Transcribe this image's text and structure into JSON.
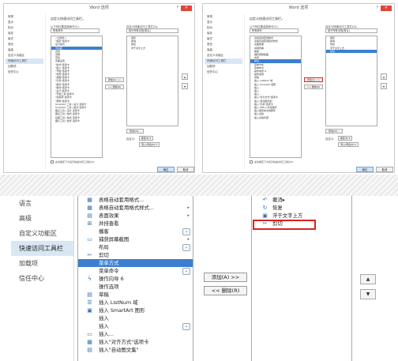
{
  "shared": {
    "window_title": "Word 选项",
    "help": "?",
    "close": "✕",
    "header": "自定义快速访问工具栏。",
    "from_label": "从下列位置选择命令(C):",
    "from_value": "所有命令",
    "customize_label": "自定义快速访问工具栏(Q):",
    "customize_value": "用于所有文档(默认)",
    "add_btn": "添加(A) >>",
    "remove_btn": "<< 删除(R)",
    "modify_btn": "修改(M)...",
    "custom_label": "自定义:",
    "reset_btn": "重置(E) ▾",
    "import_btn": "导入/导出(P) ▾",
    "ok_btn": "确定",
    "cancel_btn": "取消",
    "below_ribbon": "在功能区下方显示快速访问工具栏(H)"
  },
  "left_window": {
    "nav": [
      "常规",
      "显示",
      "校对",
      "保存",
      "版式",
      "语言",
      "高级",
      "自定义功能区",
      "快速访问工具栏",
      "加载项",
      "信任中心"
    ],
    "selected_nav": 8,
    "commands": [
      "<分隔符>",
      "\"保存\"选项卡",
      "显示格式",
      "页边距",
      "页眉",
      "页脚",
      "页码",
      "页面设置",
      "\"版式\"选项卡",
      "\"插入\"选项卡",
      "\"开始\"选项卡",
      "\"布局\"选项卡",
      "\"视图\"选项卡",
      "\"引用\"选项卡",
      "\"邮件\"选项卡",
      "\"审阅\"选项卡",
      "\"设计\"选项卡",
      "\"开发工具\"选项卡",
      "\"加载项\"选项卡",
      "\"帮助\"选项卡",
      "SmartArt 工具 | 设计 选项卡",
      "SmartArt 工具 | 格式 选项卡",
      "图表工具 | 设计 选项卡",
      "图表工具 | 格式 选项卡",
      "绘图工具 | 格式 选项卡",
      "图片工具 | 格式 选项卡"
    ],
    "selected_command": 3,
    "qat": [
      "保存",
      "撤消",
      "恢复",
      "浮于文字上方"
    ]
  },
  "right_window": {
    "nav": [
      "常规",
      "显示",
      "校对",
      "保存",
      "版式",
      "语言",
      "高级",
      "自定义功能区",
      "快速访问工具栏",
      "加载项",
      "信任中心"
    ],
    "selected_nav": 8,
    "commands": [
      "表格自动套用格式",
      "表格自动套用格式样式",
      "表面效果",
      "并排查看",
      "播客",
      "捕获屏幕截图",
      "布局",
      "剪切",
      "菜单方式",
      "菜单命令",
      "操作向导 6",
      "操作选项",
      "草稿",
      "插入 ListNum 域",
      "插入 SmartArt 图形",
      "插入",
      "插入",
      "插入...",
      "插入\"对齐方式\"选项卡",
      "插入\"自动图文集\"",
      "插入\"引用\"选项卡",
      "插入 Office 外接程序",
      "插入保存的文档部件",
      "插入表格",
      "插入表格标题"
    ],
    "selected_command": 7,
    "qat": [
      "保存",
      "撤消",
      "恢复",
      "浮于文字上方",
      "剪切"
    ]
  },
  "zoom": {
    "nav": [
      "语言",
      "高级",
      "自定义功能区",
      "快速访问工具栏",
      "加载项",
      "信任中心"
    ],
    "selected_nav": 3,
    "commands": [
      {
        "label": "表格自动套用格式...",
        "icon": "table-format-icon",
        "glyph": "▦"
      },
      {
        "label": "表格自动套用格式样式...",
        "icon": "table-style-icon",
        "glyph": "▦",
        "arrow": true
      },
      {
        "label": "表面效果",
        "icon": "surface-effect-icon",
        "glyph": "▤",
        "arrow": true
      },
      {
        "label": "并排查看",
        "icon": "side-by-side-icon",
        "glyph": "⊞"
      },
      {
        "label": "播客",
        "icon": "podcast-icon",
        "glyph": "",
        "plus": true
      },
      {
        "label": "捕获屏幕截图",
        "icon": "screenshot-icon",
        "glyph": "▭",
        "arrow": true
      },
      {
        "label": "布局",
        "icon": "layout-icon",
        "glyph": "",
        "plus": true
      },
      {
        "label": "剪切",
        "icon": "scissors-icon",
        "glyph": "✂"
      },
      {
        "label": "菜单方式",
        "icon": "menu-style-icon",
        "glyph": ""
      },
      {
        "label": "菜单命令",
        "icon": "menu-command-icon",
        "glyph": "",
        "plus": true
      },
      {
        "label": "操作向导 6",
        "icon": "lightning-icon",
        "glyph": "ϟ"
      },
      {
        "label": "操作选项",
        "icon": "action-options-icon",
        "glyph": ""
      },
      {
        "label": "草稿",
        "icon": "draft-icon",
        "glyph": "▤"
      },
      {
        "label": "插入 ListNum 域",
        "icon": "listnum-icon",
        "glyph": "☰"
      },
      {
        "label": "插入 SmartArt 图形",
        "icon": "smartart-icon",
        "glyph": "▣"
      },
      {
        "label": "插入",
        "icon": "insert-icon",
        "glyph": ""
      },
      {
        "label": "插入",
        "icon": "insert-icon",
        "glyph": "",
        "plus": true
      },
      {
        "label": "插入...",
        "icon": "insert-dialog-icon",
        "glyph": "▭"
      },
      {
        "label": "插入\"对齐方式\"选项卡",
        "icon": "align-tab-icon",
        "glyph": "▦"
      },
      {
        "label": "插入\"自动图文集\"",
        "icon": "autotext-icon",
        "glyph": "▤"
      }
    ],
    "selected_command": 8,
    "add_btn": "添加(A) >>",
    "remove_btn": "<< 删除(R)",
    "qat": [
      {
        "label": "撤消",
        "icon": "undo-icon",
        "glyph": "↶",
        "arrow": true
      },
      {
        "label": "恢复",
        "icon": "redo-icon",
        "glyph": "↻"
      },
      {
        "label": "浮于文字上方",
        "icon": "float-text-icon",
        "glyph": "▣"
      },
      {
        "label": "剪切",
        "icon": "scissors-icon",
        "glyph": "✂"
      }
    ],
    "up_arrow": "▲",
    "down_arrow": "▼"
  }
}
